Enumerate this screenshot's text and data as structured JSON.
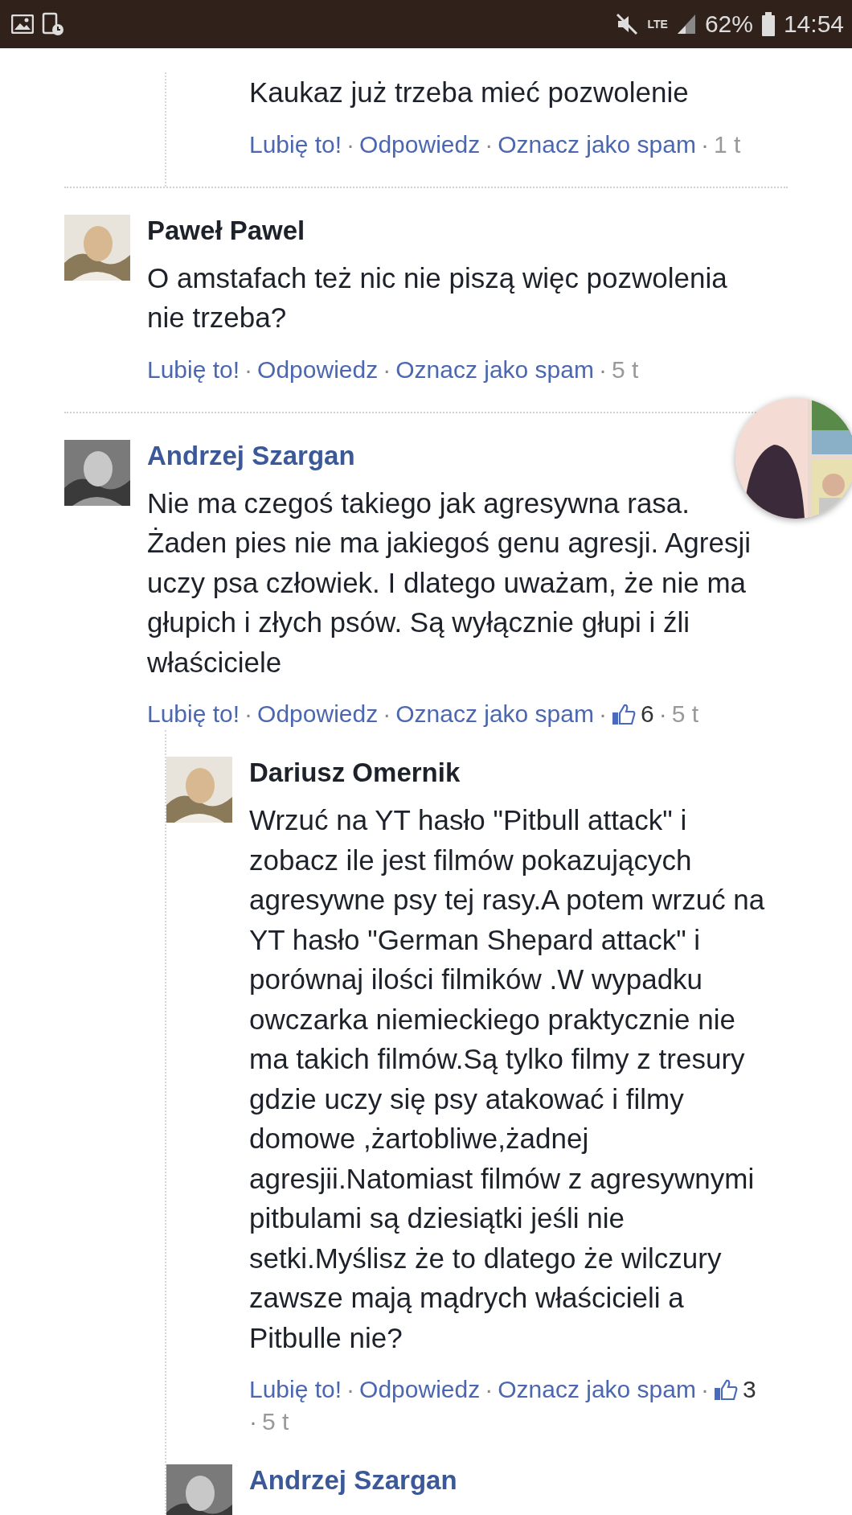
{
  "status_bar": {
    "network": "LTE",
    "battery": "62%",
    "time": "14:54"
  },
  "separator": "·",
  "comments": [
    {
      "replies": [
        {
          "text": "Kaukaz już trzeba mieć pozwolenie",
          "actions": {
            "like": "Lubię to!",
            "reply": "Odpowiedz",
            "spam": "Oznacz jako spam",
            "time": "1 t"
          }
        }
      ]
    },
    {
      "author": "Paweł Pawel",
      "linked": false,
      "text": "O amstafach też nic nie piszą więc pozwolenia\nnie trzeba?",
      "actions": {
        "like": "Lubię to!",
        "reply": "Odpowiedz",
        "spam": "Oznacz jako spam",
        "time": "5 t"
      }
    },
    {
      "author": "Andrzej Szargan",
      "linked": true,
      "text": "Nie ma czegoś takiego jak agresywna rasa.\nŻaden pies nie ma jakiegoś genu agresji. Agresji\nuczy psa człowiek. I dlatego uważam, że nie ma\ngłupich i złych psów. Są wyłącznie głupi i źli\nwłaściciele",
      "actions": {
        "like": "Lubię to!",
        "reply": "Odpowiedz",
        "spam": "Oznacz jako spam",
        "likes": "6",
        "time": "5 t"
      },
      "replies": [
        {
          "author": "Dariusz Omernik",
          "linked": false,
          "text": "Wrzuć na YT hasło \"Pitbull attack\" i\nzobacz ile jest filmów pokazujących\nagresywne psy tej rasy.A potem wrzuć na\nYT hasło \"German Shepard attack\" i\nporównaj ilości filmików .W wypadku\nowczarka niemieckiego praktycznie nie\nma takich filmów.Są tylko filmy z tresury\ngdzie uczy się psy atakować i filmy\ndomowe ,żartobliwe,żadnej\nagresjii.Natomiast filmów z agresywnymi\npitbulami są dziesiątki jeśli nie\nsetki.Myślisz że to dlatego że wilczury\nzawsze mają mądrych właścicieli a\nPitbulle nie?",
          "actions": {
            "like": "Lubię to!",
            "reply": "Odpowiedz",
            "spam": "Oznacz jako spam",
            "likes": "3",
            "time": "5 t"
          }
        },
        {
          "author": "Andrzej Szargan",
          "linked": true
        }
      ]
    }
  ]
}
